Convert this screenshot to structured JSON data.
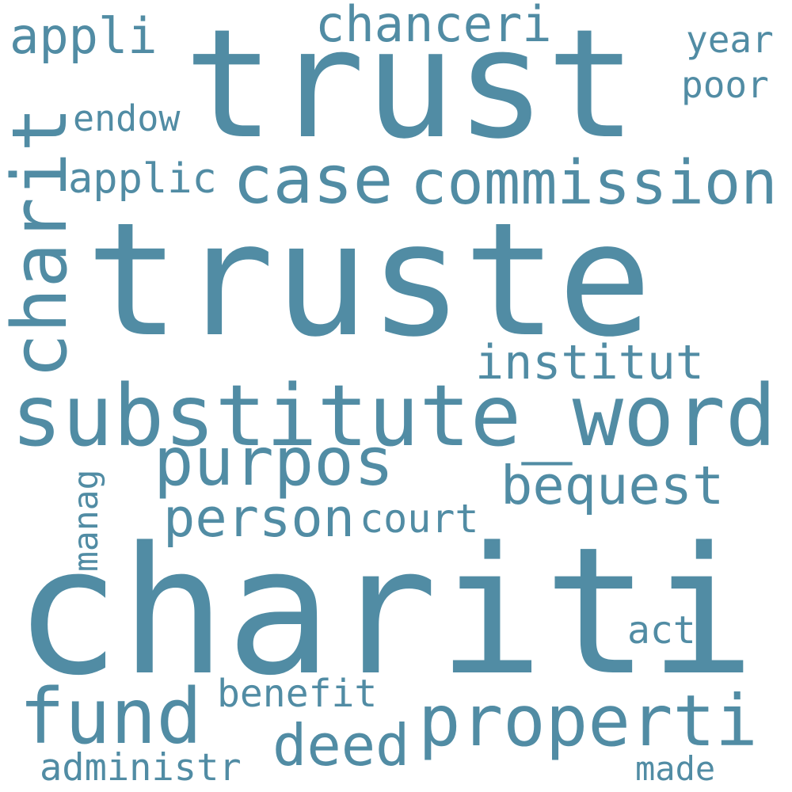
{
  "wordcloud": {
    "color": "#518ca4",
    "words": [
      {
        "text": "chariti",
        "weight": 1.0
      },
      {
        "text": "truste",
        "weight": 0.88
      },
      {
        "text": "trust",
        "weight": 0.84
      },
      {
        "text": "substitute_word",
        "weight": 0.5
      },
      {
        "text": "charit",
        "weight": 0.45
      },
      {
        "text": "properti",
        "weight": 0.4
      },
      {
        "text": "case",
        "weight": 0.38
      },
      {
        "text": "commission",
        "weight": 0.38
      },
      {
        "text": "purpos",
        "weight": 0.36
      },
      {
        "text": "fund",
        "weight": 0.36
      },
      {
        "text": "deed",
        "weight": 0.3
      },
      {
        "text": "bequest",
        "weight": 0.3
      },
      {
        "text": "person",
        "weight": 0.29
      },
      {
        "text": "chanceri",
        "weight": 0.27
      },
      {
        "text": "appli",
        "weight": 0.27
      },
      {
        "text": "institut",
        "weight": 0.27
      },
      {
        "text": "applic",
        "weight": 0.24
      },
      {
        "text": "court",
        "weight": 0.22
      },
      {
        "text": "benefit",
        "weight": 0.22
      },
      {
        "text": "administr",
        "weight": 0.22
      },
      {
        "text": "act",
        "weight": 0.2
      },
      {
        "text": "year",
        "weight": 0.2
      },
      {
        "text": "poor",
        "weight": 0.2
      },
      {
        "text": "endow",
        "weight": 0.2
      },
      {
        "text": "made",
        "weight": 0.18
      },
      {
        "text": "manag",
        "weight": 0.18
      }
    ]
  }
}
